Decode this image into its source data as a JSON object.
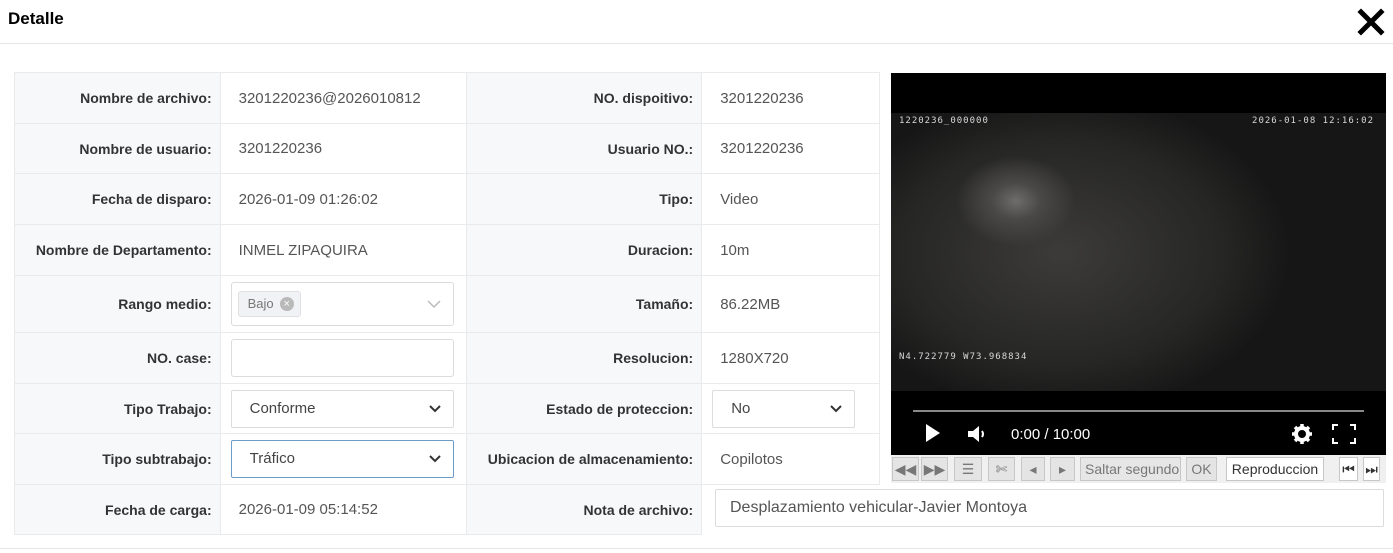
{
  "header": {
    "title": "Detalle",
    "close_icon": "close-icon"
  },
  "fields": {
    "nombre_archivo": {
      "label": "Nombre de archivo:",
      "value": "3201220236@2026010812"
    },
    "nombre_usuario": {
      "label": "Nombre de usuario:",
      "value": "3201220236"
    },
    "fecha_disparo": {
      "label": "Fecha de disparo:",
      "value": "2026-01-09 01:26:02"
    },
    "nombre_departamento": {
      "label": "Nombre de Departamento:",
      "value": "INMEL ZIPAQUIRA"
    },
    "rango_medio": {
      "label": "Rango medio:",
      "tag": "Bajo"
    },
    "no_case": {
      "label": "NO. case:",
      "value": ""
    },
    "tipo_trabajo": {
      "label": "Tipo Trabajo:",
      "value": "Conforme"
    },
    "tipo_subtrabajo": {
      "label": "Tipo subtrabajo:",
      "value": "Tráfico"
    },
    "fecha_carga": {
      "label": "Fecha de carga:",
      "value": "2026-01-09 05:14:52"
    },
    "no_dispositivo": {
      "label": "NO. dispoitivo:",
      "value": "3201220236"
    },
    "usuario_no": {
      "label": "Usuario NO.:",
      "value": "3201220236"
    },
    "tipo": {
      "label": "Tipo:",
      "value": "Video"
    },
    "duracion": {
      "label": "Duracion:",
      "value": "10m"
    },
    "tamano": {
      "label": "Tamaño:",
      "value": "86.22MB"
    },
    "resolucion": {
      "label": "Resolucion:",
      "value": "1280X720"
    },
    "estado_proteccion": {
      "label": "Estado de proteccion:",
      "value": "No"
    },
    "ubicacion": {
      "label": "Ubicacion de almacenamiento:",
      "value": "Copilotos"
    },
    "nota_archivo": {
      "label": "Nota de archivo:",
      "value": "Desplazamiento vehicular-Javier Montoya"
    }
  },
  "player": {
    "osd_top_left": "1220236_000000",
    "osd_top_right": "2026-01-08 12:16:02",
    "osd_gps": "N4.722779 W73.968834",
    "time_display": "0:00 / 10:00",
    "progress": 0
  },
  "toolbar": {
    "skip_placeholder": "Saltar segundo",
    "ok_label": "OK",
    "play_label": "Reproduccion"
  }
}
